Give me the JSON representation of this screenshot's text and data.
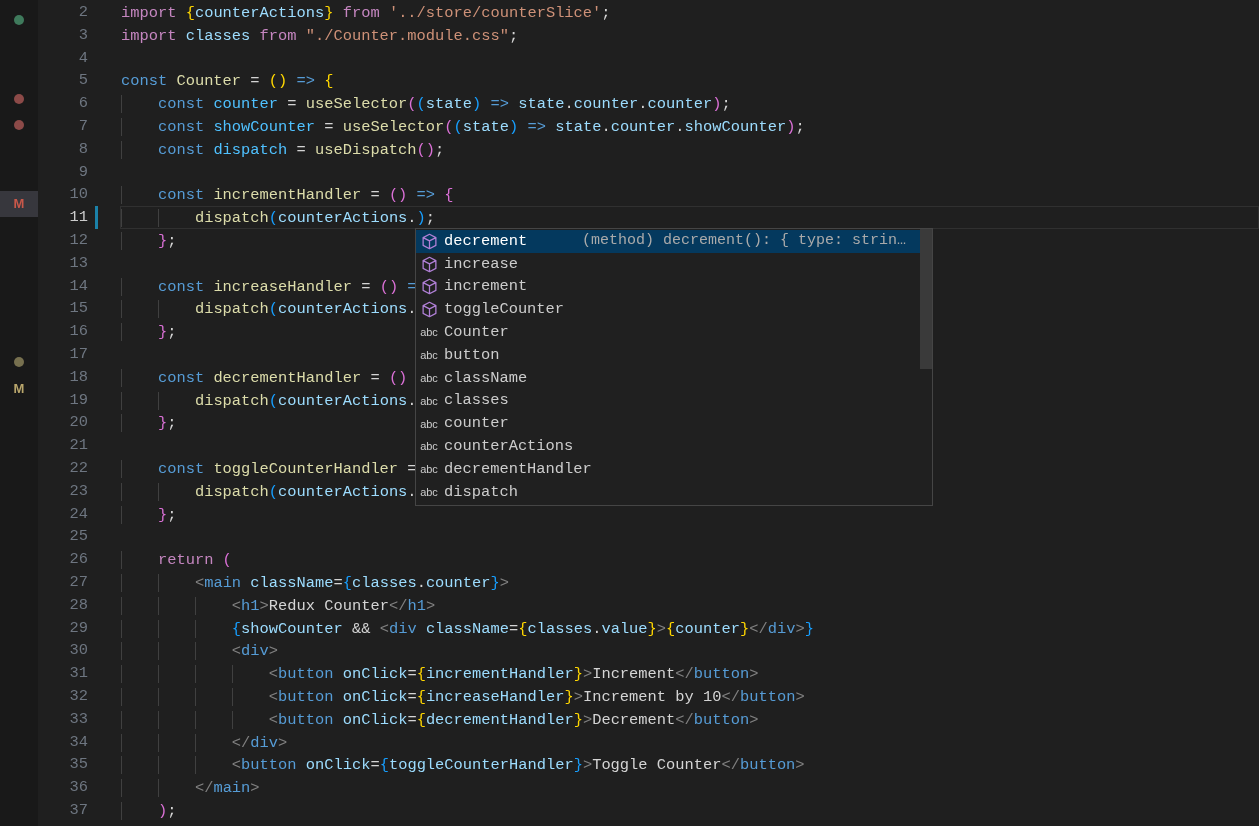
{
  "explorer_rows": [
    {
      "selected": false,
      "mark": {
        "kind": "dot",
        "color": "#3f7a5c"
      }
    },
    {
      "selected": false
    },
    {
      "selected": false
    },
    {
      "selected": false,
      "mark": {
        "kind": "dot",
        "color": "#8c4a48"
      }
    },
    {
      "selected": false,
      "mark": {
        "kind": "dot",
        "color": "#8c4a48"
      }
    },
    {
      "selected": false
    },
    {
      "selected": false
    },
    {
      "selected": true,
      "mark": {
        "kind": "badge",
        "text": "M",
        "color": "#c9584a"
      }
    },
    {
      "selected": false
    },
    {
      "selected": false
    },
    {
      "selected": false
    },
    {
      "selected": false
    },
    {
      "selected": false
    },
    {
      "selected": false,
      "mark": {
        "kind": "dot",
        "color": "#77704f"
      }
    },
    {
      "selected": false,
      "mark": {
        "kind": "badge",
        "text": "M",
        "color": "#b9a66c"
      }
    }
  ],
  "lines": [
    {
      "n": "2",
      "current": false,
      "changed": false,
      "tokens": [
        {
          "text": "import ",
          "kind": "kw"
        },
        {
          "text": "{",
          "kind": "b1"
        },
        {
          "text": "counterActions",
          "kind": "v"
        },
        {
          "text": "}",
          "kind": "b1"
        },
        {
          "text": " from ",
          "kind": "kw"
        },
        {
          "text": "'../store/counterSlice'",
          "kind": "s"
        },
        {
          "text": ";",
          "kind": "p"
        }
      ]
    },
    {
      "n": "3",
      "current": false,
      "changed": false,
      "tokens": [
        {
          "text": "import ",
          "kind": "kw"
        },
        {
          "text": "classes",
          "kind": "v"
        },
        {
          "text": " from ",
          "kind": "kw"
        },
        {
          "text": "\"./Counter.module.css\"",
          "kind": "s"
        },
        {
          "text": ";",
          "kind": "p"
        }
      ]
    },
    {
      "n": "4",
      "current": false,
      "changed": false
    },
    {
      "n": "5",
      "current": false,
      "changed": false,
      "tokens": [
        {
          "text": "const ",
          "kind": "st"
        },
        {
          "text": "Counter",
          "kind": "f"
        },
        {
          "text": " = ",
          "kind": "p"
        },
        {
          "text": "()",
          "kind": "b1"
        },
        {
          "text": " => ",
          "kind": "st"
        },
        {
          "text": "{",
          "kind": "b1"
        }
      ]
    },
    {
      "n": "6",
      "current": false,
      "changed": false,
      "tokens": [
        {
          "text": "    const ",
          "kind": "st"
        },
        {
          "text": "counter",
          "kind": "c"
        },
        {
          "text": " = ",
          "kind": "p"
        },
        {
          "text": "useSelector",
          "kind": "f"
        },
        {
          "text": "(",
          "kind": "b2"
        },
        {
          "text": "(",
          "kind": "b3"
        },
        {
          "text": "state",
          "kind": "v"
        },
        {
          "text": ")",
          "kind": "b3"
        },
        {
          "text": " => ",
          "kind": "st"
        },
        {
          "text": "state",
          "kind": "v"
        },
        {
          "text": ".",
          "kind": "p"
        },
        {
          "text": "counter",
          "kind": "v"
        },
        {
          "text": ".",
          "kind": "p"
        },
        {
          "text": "counter",
          "kind": "v"
        },
        {
          "text": ")",
          "kind": "b2"
        },
        {
          "text": ";",
          "kind": "p"
        }
      ]
    },
    {
      "n": "7",
      "current": false,
      "changed": false,
      "tokens": [
        {
          "text": "    const ",
          "kind": "st"
        },
        {
          "text": "showCounter",
          "kind": "c"
        },
        {
          "text": " = ",
          "kind": "p"
        },
        {
          "text": "useSelector",
          "kind": "f"
        },
        {
          "text": "(",
          "kind": "b2"
        },
        {
          "text": "(",
          "kind": "b3"
        },
        {
          "text": "state",
          "kind": "v"
        },
        {
          "text": ")",
          "kind": "b3"
        },
        {
          "text": " => ",
          "kind": "st"
        },
        {
          "text": "state",
          "kind": "v"
        },
        {
          "text": ".",
          "kind": "p"
        },
        {
          "text": "counter",
          "kind": "v"
        },
        {
          "text": ".",
          "kind": "p"
        },
        {
          "text": "showCounter",
          "kind": "v"
        },
        {
          "text": ")",
          "kind": "b2"
        },
        {
          "text": ";",
          "kind": "p"
        }
      ]
    },
    {
      "n": "8",
      "current": false,
      "changed": false,
      "tokens": [
        {
          "text": "    const ",
          "kind": "st"
        },
        {
          "text": "dispatch",
          "kind": "c"
        },
        {
          "text": " = ",
          "kind": "p"
        },
        {
          "text": "useDispatch",
          "kind": "f"
        },
        {
          "text": "()",
          "kind": "b2"
        },
        {
          "text": ";",
          "kind": "p"
        }
      ]
    },
    {
      "n": "9",
      "current": false,
      "changed": false
    },
    {
      "n": "10",
      "current": false,
      "changed": false,
      "tokens": [
        {
          "text": "    const ",
          "kind": "st"
        },
        {
          "text": "incrementHandler",
          "kind": "f"
        },
        {
          "text": " = ",
          "kind": "p"
        },
        {
          "text": "()",
          "kind": "b2"
        },
        {
          "text": " => ",
          "kind": "st"
        },
        {
          "text": "{",
          "kind": "b2"
        }
      ]
    },
    {
      "n": "11",
      "current": true,
      "changed": true,
      "tokens": [
        {
          "text": "        dispatch",
          "kind": "f"
        },
        {
          "text": "(",
          "kind": "b3"
        },
        {
          "text": "counterActions",
          "kind": "v"
        },
        {
          "text": ".",
          "kind": "p"
        },
        {
          "text": ")",
          "kind": "b3"
        },
        {
          "text": ";",
          "kind": "p"
        }
      ]
    },
    {
      "n": "12",
      "current": false,
      "changed": false,
      "tokens": [
        {
          "text": "    }",
          "kind": "b2"
        },
        {
          "text": ";",
          "kind": "p"
        }
      ]
    },
    {
      "n": "13",
      "current": false,
      "changed": false
    },
    {
      "n": "14",
      "current": false,
      "changed": false,
      "tokens": [
        {
          "text": "    const ",
          "kind": "st"
        },
        {
          "text": "increaseHandler",
          "kind": "f"
        },
        {
          "text": " = ",
          "kind": "p"
        },
        {
          "text": "()",
          "kind": "b2"
        },
        {
          "text": " =",
          "kind": "st"
        }
      ]
    },
    {
      "n": "15",
      "current": false,
      "changed": false,
      "tokens": [
        {
          "text": "        dispatch",
          "kind": "f"
        },
        {
          "text": "(",
          "kind": "b3"
        },
        {
          "text": "counterActions",
          "kind": "v"
        },
        {
          "text": ".",
          "kind": "p"
        }
      ]
    },
    {
      "n": "16",
      "current": false,
      "changed": false,
      "tokens": [
        {
          "text": "    }",
          "kind": "b2"
        },
        {
          "text": ";",
          "kind": "p"
        }
      ]
    },
    {
      "n": "17",
      "current": false,
      "changed": false
    },
    {
      "n": "18",
      "current": false,
      "changed": false,
      "tokens": [
        {
          "text": "    const ",
          "kind": "st"
        },
        {
          "text": "decrementHandler",
          "kind": "f"
        },
        {
          "text": " = ",
          "kind": "p"
        },
        {
          "text": "()",
          "kind": "b2"
        }
      ]
    },
    {
      "n": "19",
      "current": false,
      "changed": false,
      "tokens": [
        {
          "text": "        dispatch",
          "kind": "f"
        },
        {
          "text": "(",
          "kind": "b3"
        },
        {
          "text": "counterActions",
          "kind": "v"
        },
        {
          "text": ".",
          "kind": "p"
        }
      ]
    },
    {
      "n": "20",
      "current": false,
      "changed": false,
      "tokens": [
        {
          "text": "    }",
          "kind": "b2"
        },
        {
          "text": ";",
          "kind": "p"
        }
      ]
    },
    {
      "n": "21",
      "current": false,
      "changed": false
    },
    {
      "n": "22",
      "current": false,
      "changed": false,
      "tokens": [
        {
          "text": "    const ",
          "kind": "st"
        },
        {
          "text": "toggleCounterHandler",
          "kind": "f"
        },
        {
          "text": " =",
          "kind": "p"
        }
      ]
    },
    {
      "n": "23",
      "current": false,
      "changed": false,
      "tokens": [
        {
          "text": "        dispatch",
          "kind": "f"
        },
        {
          "text": "(",
          "kind": "b3"
        },
        {
          "text": "counterActions",
          "kind": "v"
        },
        {
          "text": ".",
          "kind": "p"
        }
      ]
    },
    {
      "n": "24",
      "current": false,
      "changed": false,
      "tokens": [
        {
          "text": "    }",
          "kind": "b2"
        },
        {
          "text": ";",
          "kind": "p"
        }
      ]
    },
    {
      "n": "25",
      "current": false,
      "changed": false
    },
    {
      "n": "26",
      "current": false,
      "changed": false,
      "tokens": [
        {
          "text": "    return ",
          "kind": "kw"
        },
        {
          "text": "(",
          "kind": "b2"
        }
      ]
    },
    {
      "n": "27",
      "current": false,
      "changed": false,
      "tokens": [
        {
          "text": "        <",
          "kind": "ang"
        },
        {
          "text": "main",
          "kind": "tag"
        },
        {
          "text": " className",
          "kind": "v"
        },
        {
          "text": "=",
          "kind": "p"
        },
        {
          "text": "{",
          "kind": "b3"
        },
        {
          "text": "classes",
          "kind": "v"
        },
        {
          "text": ".",
          "kind": "p"
        },
        {
          "text": "counter",
          "kind": "v"
        },
        {
          "text": "}",
          "kind": "b3"
        },
        {
          "text": ">",
          "kind": "ang"
        }
      ]
    },
    {
      "n": "28",
      "current": false,
      "changed": false,
      "tokens": [
        {
          "text": "            <",
          "kind": "ang"
        },
        {
          "text": "h1",
          "kind": "tag"
        },
        {
          "text": ">",
          "kind": "ang"
        },
        {
          "text": "Redux Counter",
          "kind": "p"
        },
        {
          "text": "</",
          "kind": "ang"
        },
        {
          "text": "h1",
          "kind": "tag"
        },
        {
          "text": ">",
          "kind": "ang"
        }
      ]
    },
    {
      "n": "29",
      "current": false,
      "changed": false,
      "tokens": [
        {
          "text": "            {",
          "kind": "b3"
        },
        {
          "text": "showCounter",
          "kind": "v"
        },
        {
          "text": " && ",
          "kind": "p"
        },
        {
          "text": "<",
          "kind": "ang"
        },
        {
          "text": "div",
          "kind": "tag"
        },
        {
          "text": " className",
          "kind": "v"
        },
        {
          "text": "=",
          "kind": "p"
        },
        {
          "text": "{",
          "kind": "b1"
        },
        {
          "text": "classes",
          "kind": "v"
        },
        {
          "text": ".",
          "kind": "p"
        },
        {
          "text": "value",
          "kind": "v"
        },
        {
          "text": "}",
          "kind": "b1"
        },
        {
          "text": ">",
          "kind": "ang"
        },
        {
          "text": "{",
          "kind": "b1"
        },
        {
          "text": "counter",
          "kind": "v"
        },
        {
          "text": "}",
          "kind": "b1"
        },
        {
          "text": "</",
          "kind": "ang"
        },
        {
          "text": "div",
          "kind": "tag"
        },
        {
          "text": ">",
          "kind": "ang"
        },
        {
          "text": "}",
          "kind": "b3"
        }
      ]
    },
    {
      "n": "30",
      "current": false,
      "changed": false,
      "tokens": [
        {
          "text": "            <",
          "kind": "ang"
        },
        {
          "text": "div",
          "kind": "tag"
        },
        {
          "text": ">",
          "kind": "ang"
        }
      ]
    },
    {
      "n": "31",
      "current": false,
      "changed": false,
      "tokens": [
        {
          "text": "                <",
          "kind": "ang"
        },
        {
          "text": "button",
          "kind": "tag"
        },
        {
          "text": " onClick",
          "kind": "v"
        },
        {
          "text": "=",
          "kind": "p"
        },
        {
          "text": "{",
          "kind": "b1"
        },
        {
          "text": "incrementHandler",
          "kind": "v"
        },
        {
          "text": "}",
          "kind": "b1"
        },
        {
          "text": ">",
          "kind": "ang"
        },
        {
          "text": "Increment",
          "kind": "p"
        },
        {
          "text": "</",
          "kind": "ang"
        },
        {
          "text": "button",
          "kind": "tag"
        },
        {
          "text": ">",
          "kind": "ang"
        }
      ]
    },
    {
      "n": "32",
      "current": false,
      "changed": false,
      "tokens": [
        {
          "text": "                <",
          "kind": "ang"
        },
        {
          "text": "button",
          "kind": "tag"
        },
        {
          "text": " onClick",
          "kind": "v"
        },
        {
          "text": "=",
          "kind": "p"
        },
        {
          "text": "{",
          "kind": "b1"
        },
        {
          "text": "increaseHandler",
          "kind": "v"
        },
        {
          "text": "}",
          "kind": "b1"
        },
        {
          "text": ">",
          "kind": "ang"
        },
        {
          "text": "Increment by 10",
          "kind": "p"
        },
        {
          "text": "</",
          "kind": "ang"
        },
        {
          "text": "button",
          "kind": "tag"
        },
        {
          "text": ">",
          "kind": "ang"
        }
      ]
    },
    {
      "n": "33",
      "current": false,
      "changed": false,
      "tokens": [
        {
          "text": "                <",
          "kind": "ang"
        },
        {
          "text": "button",
          "kind": "tag"
        },
        {
          "text": " onClick",
          "kind": "v"
        },
        {
          "text": "=",
          "kind": "p"
        },
        {
          "text": "{",
          "kind": "b1"
        },
        {
          "text": "decrementHandler",
          "kind": "v"
        },
        {
          "text": "}",
          "kind": "b1"
        },
        {
          "text": ">",
          "kind": "ang"
        },
        {
          "text": "Decrement",
          "kind": "p"
        },
        {
          "text": "</",
          "kind": "ang"
        },
        {
          "text": "button",
          "kind": "tag"
        },
        {
          "text": ">",
          "kind": "ang"
        }
      ]
    },
    {
      "n": "34",
      "current": false,
      "changed": false,
      "tokens": [
        {
          "text": "            </",
          "kind": "ang"
        },
        {
          "text": "div",
          "kind": "tag"
        },
        {
          "text": ">",
          "kind": "ang"
        }
      ]
    },
    {
      "n": "35",
      "current": false,
      "changed": false,
      "tokens": [
        {
          "text": "            <",
          "kind": "ang"
        },
        {
          "text": "button",
          "kind": "tag"
        },
        {
          "text": " onClick",
          "kind": "v"
        },
        {
          "text": "=",
          "kind": "p"
        },
        {
          "text": "{",
          "kind": "b3"
        },
        {
          "text": "toggleCounterHandler",
          "kind": "v"
        },
        {
          "text": "}",
          "kind": "b3"
        },
        {
          "text": ">",
          "kind": "ang"
        },
        {
          "text": "Toggle Counter",
          "kind": "p"
        },
        {
          "text": "</",
          "kind": "ang"
        },
        {
          "text": "button",
          "kind": "tag"
        },
        {
          "text": ">",
          "kind": "ang"
        }
      ]
    },
    {
      "n": "36",
      "current": false,
      "changed": false,
      "tokens": [
        {
          "text": "        </",
          "kind": "ang"
        },
        {
          "text": "main",
          "kind": "tag"
        },
        {
          "text": ">",
          "kind": "ang"
        }
      ]
    },
    {
      "n": "37",
      "current": false,
      "changed": false,
      "tokens": [
        {
          "text": "    )",
          "kind": "b2"
        },
        {
          "text": ";",
          "kind": "p"
        }
      ]
    }
  ],
  "suggestions": [
    {
      "kind": "method",
      "label": "decrement",
      "selected": true,
      "detail": "(method) decrement(): { type: strin…"
    },
    {
      "kind": "method",
      "label": "increase",
      "selected": false
    },
    {
      "kind": "method",
      "label": "increment",
      "selected": false
    },
    {
      "kind": "method",
      "label": "toggleCounter",
      "selected": false
    },
    {
      "kind": "word",
      "icon_text": "abc",
      "label": "Counter",
      "selected": false
    },
    {
      "kind": "word",
      "icon_text": "abc",
      "label": "button",
      "selected": false
    },
    {
      "kind": "word",
      "icon_text": "abc",
      "label": "className",
      "selected": false
    },
    {
      "kind": "word",
      "icon_text": "abc",
      "label": "classes",
      "selected": false
    },
    {
      "kind": "word",
      "icon_text": "abc",
      "label": "counter",
      "selected": false
    },
    {
      "kind": "word",
      "icon_text": "abc",
      "label": "counterActions",
      "selected": false
    },
    {
      "kind": "word",
      "icon_text": "abc",
      "label": "decrementHandler",
      "selected": false
    },
    {
      "kind": "word",
      "icon_text": "abc",
      "label": "dispatch",
      "selected": false
    }
  ]
}
